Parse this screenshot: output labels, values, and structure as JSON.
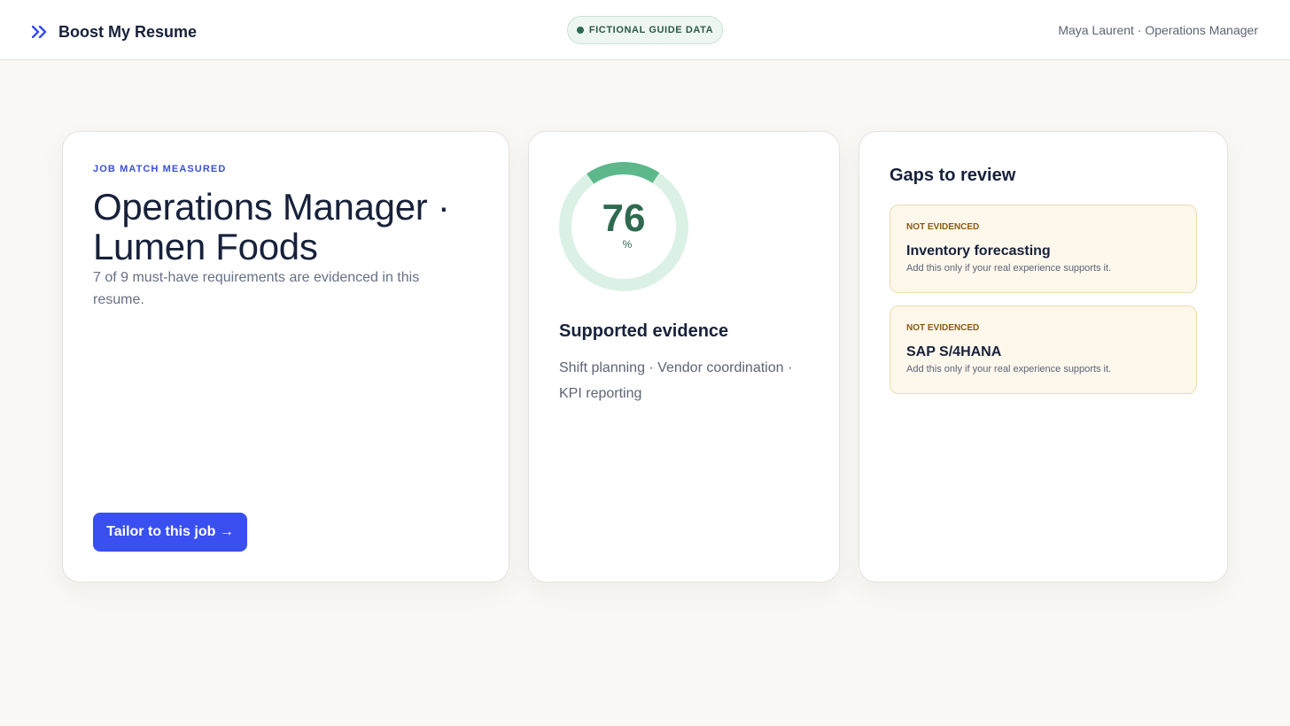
{
  "header": {
    "brand_name": "Boost My Resume",
    "badge_label": "FICTIONAL GUIDE DATA",
    "user_label": "Maya Laurent · Operations Manager"
  },
  "job_card": {
    "eyebrow": "JOB MATCH MEASURED",
    "title": "Operations Manager · Lumen Foods",
    "subtitle": "7 of 9 must-have requirements are evidenced in this resume.",
    "cta_label": "Tailor to this job →"
  },
  "score_card": {
    "score": 76,
    "score_text": "76",
    "unit": "%",
    "evidence_title": "Supported evidence",
    "evidence_text": "Shift planning · Vendor coordination · KPI reporting",
    "colors": {
      "ring_fill": "#5cb88a",
      "ring_track": "#dcf1e6",
      "score": "#2f6a4f"
    }
  },
  "gaps_card": {
    "title": "Gaps to review",
    "items": [
      {
        "status": "NOT EVIDENCED",
        "name": "Inventory forecasting",
        "note": "Add this only if your real experience supports it."
      },
      {
        "status": "NOT EVIDENCED",
        "name": "SAP S/4HANA",
        "note": "Add this only if your real experience supports it."
      }
    ]
  },
  "colors": {
    "accent": "#3a4ff0",
    "warning_label": "#8a5a14",
    "warning_bg": "#fdf7ec",
    "success": "#2f6a4f"
  }
}
